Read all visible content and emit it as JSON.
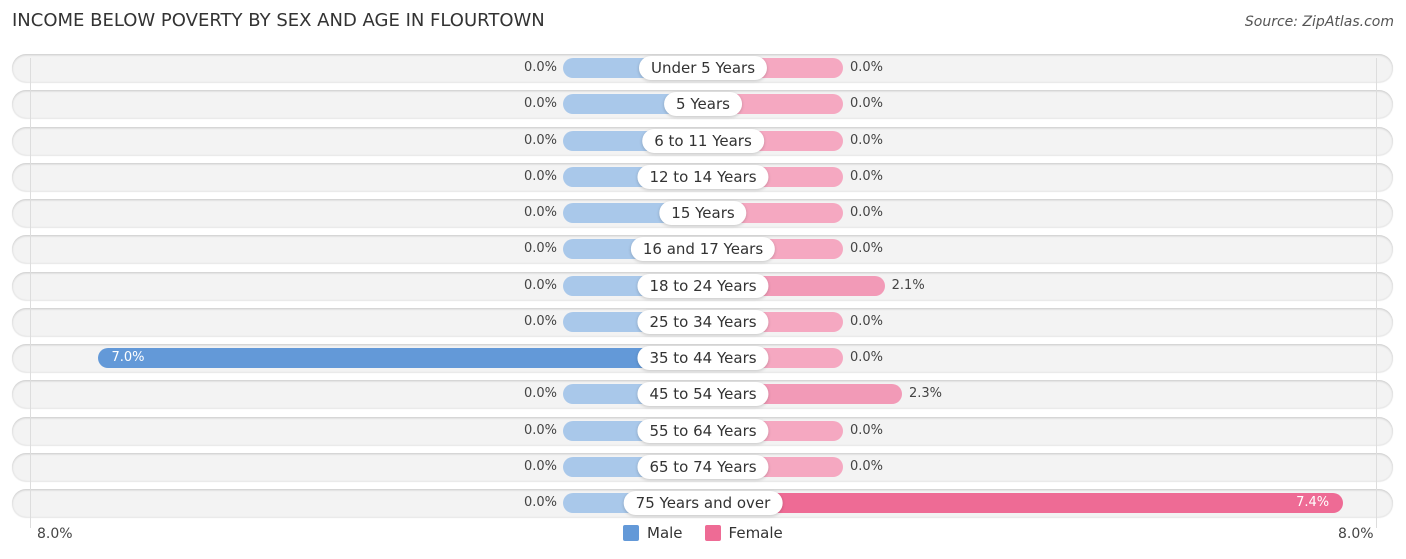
{
  "header": {
    "title": "INCOME BELOW POVERTY BY SEX AND AGE IN FLOURTOWN",
    "source": "Source: ZipAtlas.com"
  },
  "colors": {
    "male": "#a9c8ea",
    "male_strong": "#6399d8",
    "female": "#f5a8c1",
    "female_strong": "#ee6b95"
  },
  "chart_data": {
    "type": "bar",
    "orientation": "horizontal-diverging",
    "title": "INCOME BELOW POVERTY BY SEX AND AGE IN FLOURTOWN",
    "categories": [
      "Under 5 Years",
      "5 Years",
      "6 to 11 Years",
      "12 to 14 Years",
      "15 Years",
      "16 and 17 Years",
      "18 to 24 Years",
      "25 to 34 Years",
      "35 to 44 Years",
      "45 to 54 Years",
      "55 to 64 Years",
      "65 to 74 Years",
      "75 Years and over"
    ],
    "series": [
      {
        "name": "Male",
        "values": [
          0.0,
          0.0,
          0.0,
          0.0,
          0.0,
          0.0,
          0.0,
          0.0,
          7.0,
          0.0,
          0.0,
          0.0,
          0.0
        ],
        "labels": [
          "0.0%",
          "0.0%",
          "0.0%",
          "0.0%",
          "0.0%",
          "0.0%",
          "0.0%",
          "0.0%",
          "7.0%",
          "0.0%",
          "0.0%",
          "0.0%",
          "0.0%"
        ]
      },
      {
        "name": "Female",
        "values": [
          0.0,
          0.0,
          0.0,
          0.0,
          0.0,
          0.0,
          2.1,
          0.0,
          0.0,
          2.3,
          0.0,
          0.0,
          7.4
        ],
        "labels": [
          "0.0%",
          "0.0%",
          "0.0%",
          "0.0%",
          "0.0%",
          "0.0%",
          "2.1%",
          "0.0%",
          "0.0%",
          "2.3%",
          "0.0%",
          "0.0%",
          "7.4%"
        ]
      }
    ],
    "xlim": [
      -8.0,
      8.0
    ],
    "axis_labels": {
      "left": "8.0%",
      "right": "8.0%"
    },
    "legend": {
      "position": "bottom-center",
      "items": [
        "Male",
        "Female"
      ]
    }
  }
}
